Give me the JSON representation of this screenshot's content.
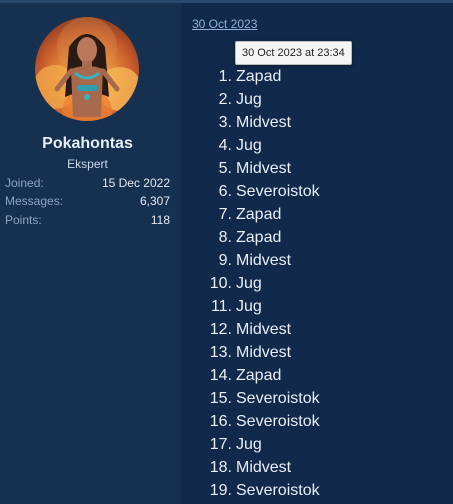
{
  "user": {
    "name": "Pokahontas",
    "title": "Ekspert",
    "stats": [
      {
        "label": "Joined:",
        "value": "15 Dec 2022"
      },
      {
        "label": "Messages:",
        "value": "6,307"
      },
      {
        "label": "Points:",
        "value": "118"
      }
    ]
  },
  "post": {
    "date": "30 Oct 2023",
    "tooltip": "30 Oct 2023 at 23:34",
    "items": [
      {
        "num": "1.",
        "text": "Zapad"
      },
      {
        "num": "2.",
        "text": "Jug"
      },
      {
        "num": "3.",
        "text": "Midvest"
      },
      {
        "num": "4.",
        "text": "Jug"
      },
      {
        "num": "5.",
        "text": "Midvest"
      },
      {
        "num": "6.",
        "text": "Severoistok"
      },
      {
        "num": "7.",
        "text": "Zapad"
      },
      {
        "num": "8.",
        "text": "Zapad"
      },
      {
        "num": "9.",
        "text": "Midvest"
      },
      {
        "num": "10.",
        "text": "Jug"
      },
      {
        "num": "11.",
        "text": "Jug"
      },
      {
        "num": "12.",
        "text": "Midvest"
      },
      {
        "num": "13.",
        "text": "Midvest"
      },
      {
        "num": "14.",
        "text": "Zapad"
      },
      {
        "num": "15.",
        "text": "Severoistok"
      },
      {
        "num": "16.",
        "text": "Severoistok"
      },
      {
        "num": "17.",
        "text": "Jug"
      },
      {
        "num": "18.",
        "text": "Midvest"
      },
      {
        "num": "19.",
        "text": "Severoistok"
      }
    ]
  },
  "colors": {
    "background": "#1d3a5c",
    "user_panel": "#163050",
    "content_panel": "#11294a",
    "link": "#8fb3d8",
    "text": "#e8eef6"
  }
}
